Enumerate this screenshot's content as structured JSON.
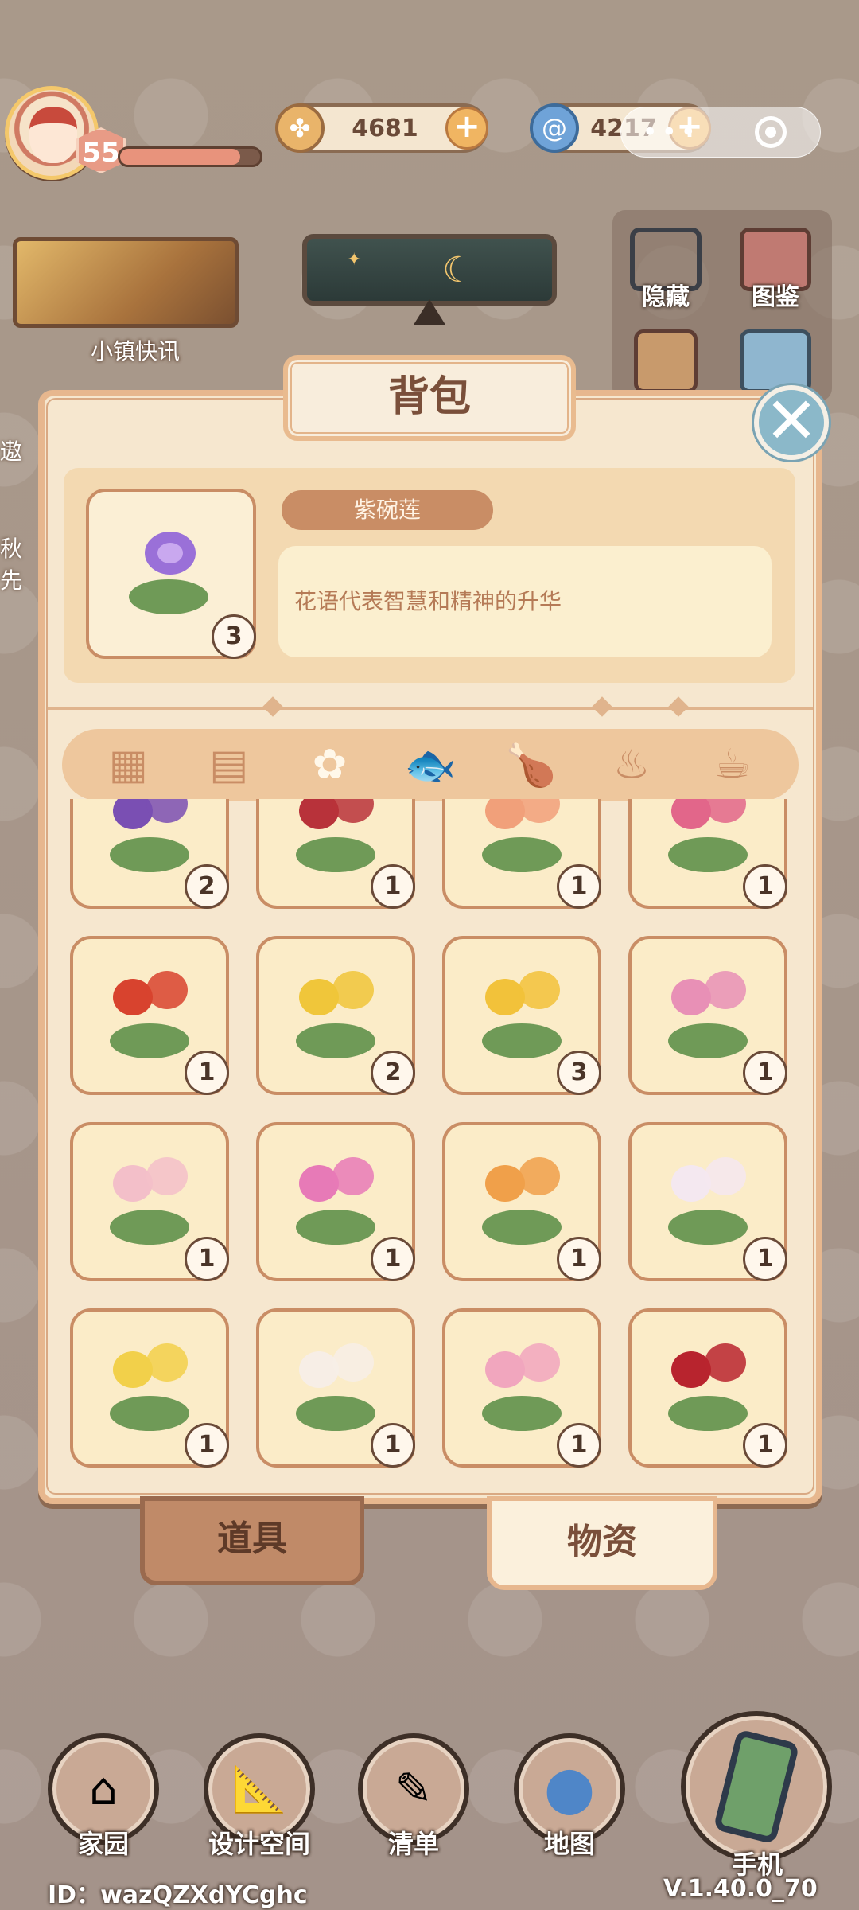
{
  "hud": {
    "level": "55",
    "xp_fraction": 0.86,
    "coins": "4681",
    "gems": "4217"
  },
  "left_widgets": {
    "news_label": "小镇快讯",
    "side_text_1": "遨",
    "side_text_2": "秋先"
  },
  "tools": {
    "hide_label": "隐藏",
    "catalog_label": "图鉴"
  },
  "backpack": {
    "title": "背包",
    "selected": {
      "name": "紫碗莲",
      "count": "3",
      "description": "花语代表智慧和精神的升华"
    },
    "categories": [
      {
        "icon": "grid-icon",
        "glyph": "▦"
      },
      {
        "icon": "seed-packet-icon",
        "glyph": "▤"
      },
      {
        "icon": "flower-icon",
        "glyph": "✿"
      },
      {
        "icon": "fish-icon",
        "glyph": "🐟"
      },
      {
        "icon": "drumstick-icon",
        "glyph": "🍗"
      },
      {
        "icon": "bowl-icon",
        "glyph": "♨"
      },
      {
        "icon": "teacup-icon",
        "glyph": "☕"
      }
    ],
    "active_category_index": 2,
    "items": [
      {
        "name": "purple-violet",
        "count": "2",
        "color": "#7a4fb3"
      },
      {
        "name": "red-white-camellia",
        "count": "1",
        "color": "#b8323a"
      },
      {
        "name": "orange-lily",
        "count": "1",
        "color": "#f1a07a"
      },
      {
        "name": "pink-peony",
        "count": "1",
        "color": "#e2668a"
      },
      {
        "name": "red-lily",
        "count": "1",
        "color": "#d8432e"
      },
      {
        "name": "yellow-daffodil",
        "count": "2",
        "color": "#f0c63a"
      },
      {
        "name": "yellow-daffodil-large",
        "count": "3",
        "color": "#f2c23a"
      },
      {
        "name": "pink-aster",
        "count": "1",
        "color": "#e890b6"
      },
      {
        "name": "pink-white-lily",
        "count": "1",
        "color": "#f3bfc9"
      },
      {
        "name": "pink-star-lily",
        "count": "1",
        "color": "#e77ab7"
      },
      {
        "name": "bird-of-paradise-orange",
        "count": "1",
        "color": "#f0a04a"
      },
      {
        "name": "white-lily",
        "count": "1",
        "color": "#f4e8f0"
      },
      {
        "name": "yellow-primrose",
        "count": "1",
        "color": "#f2d04a"
      },
      {
        "name": "white-tulip",
        "count": "1",
        "color": "#f7eee6"
      },
      {
        "name": "pink-rose",
        "count": "1",
        "color": "#f1a6be"
      },
      {
        "name": "red-rose",
        "count": "1",
        "color": "#b8242e"
      }
    ],
    "tabs": {
      "tools_label": "道具",
      "materials_label": "物资"
    }
  },
  "bottom_nav": {
    "home": "家园",
    "design": "设计空间",
    "list": "清单",
    "map": "地图",
    "phone": "手机"
  },
  "footer": {
    "id_text": "ID：wazQZXdYCghc",
    "version": "V.1.40.0_70"
  }
}
